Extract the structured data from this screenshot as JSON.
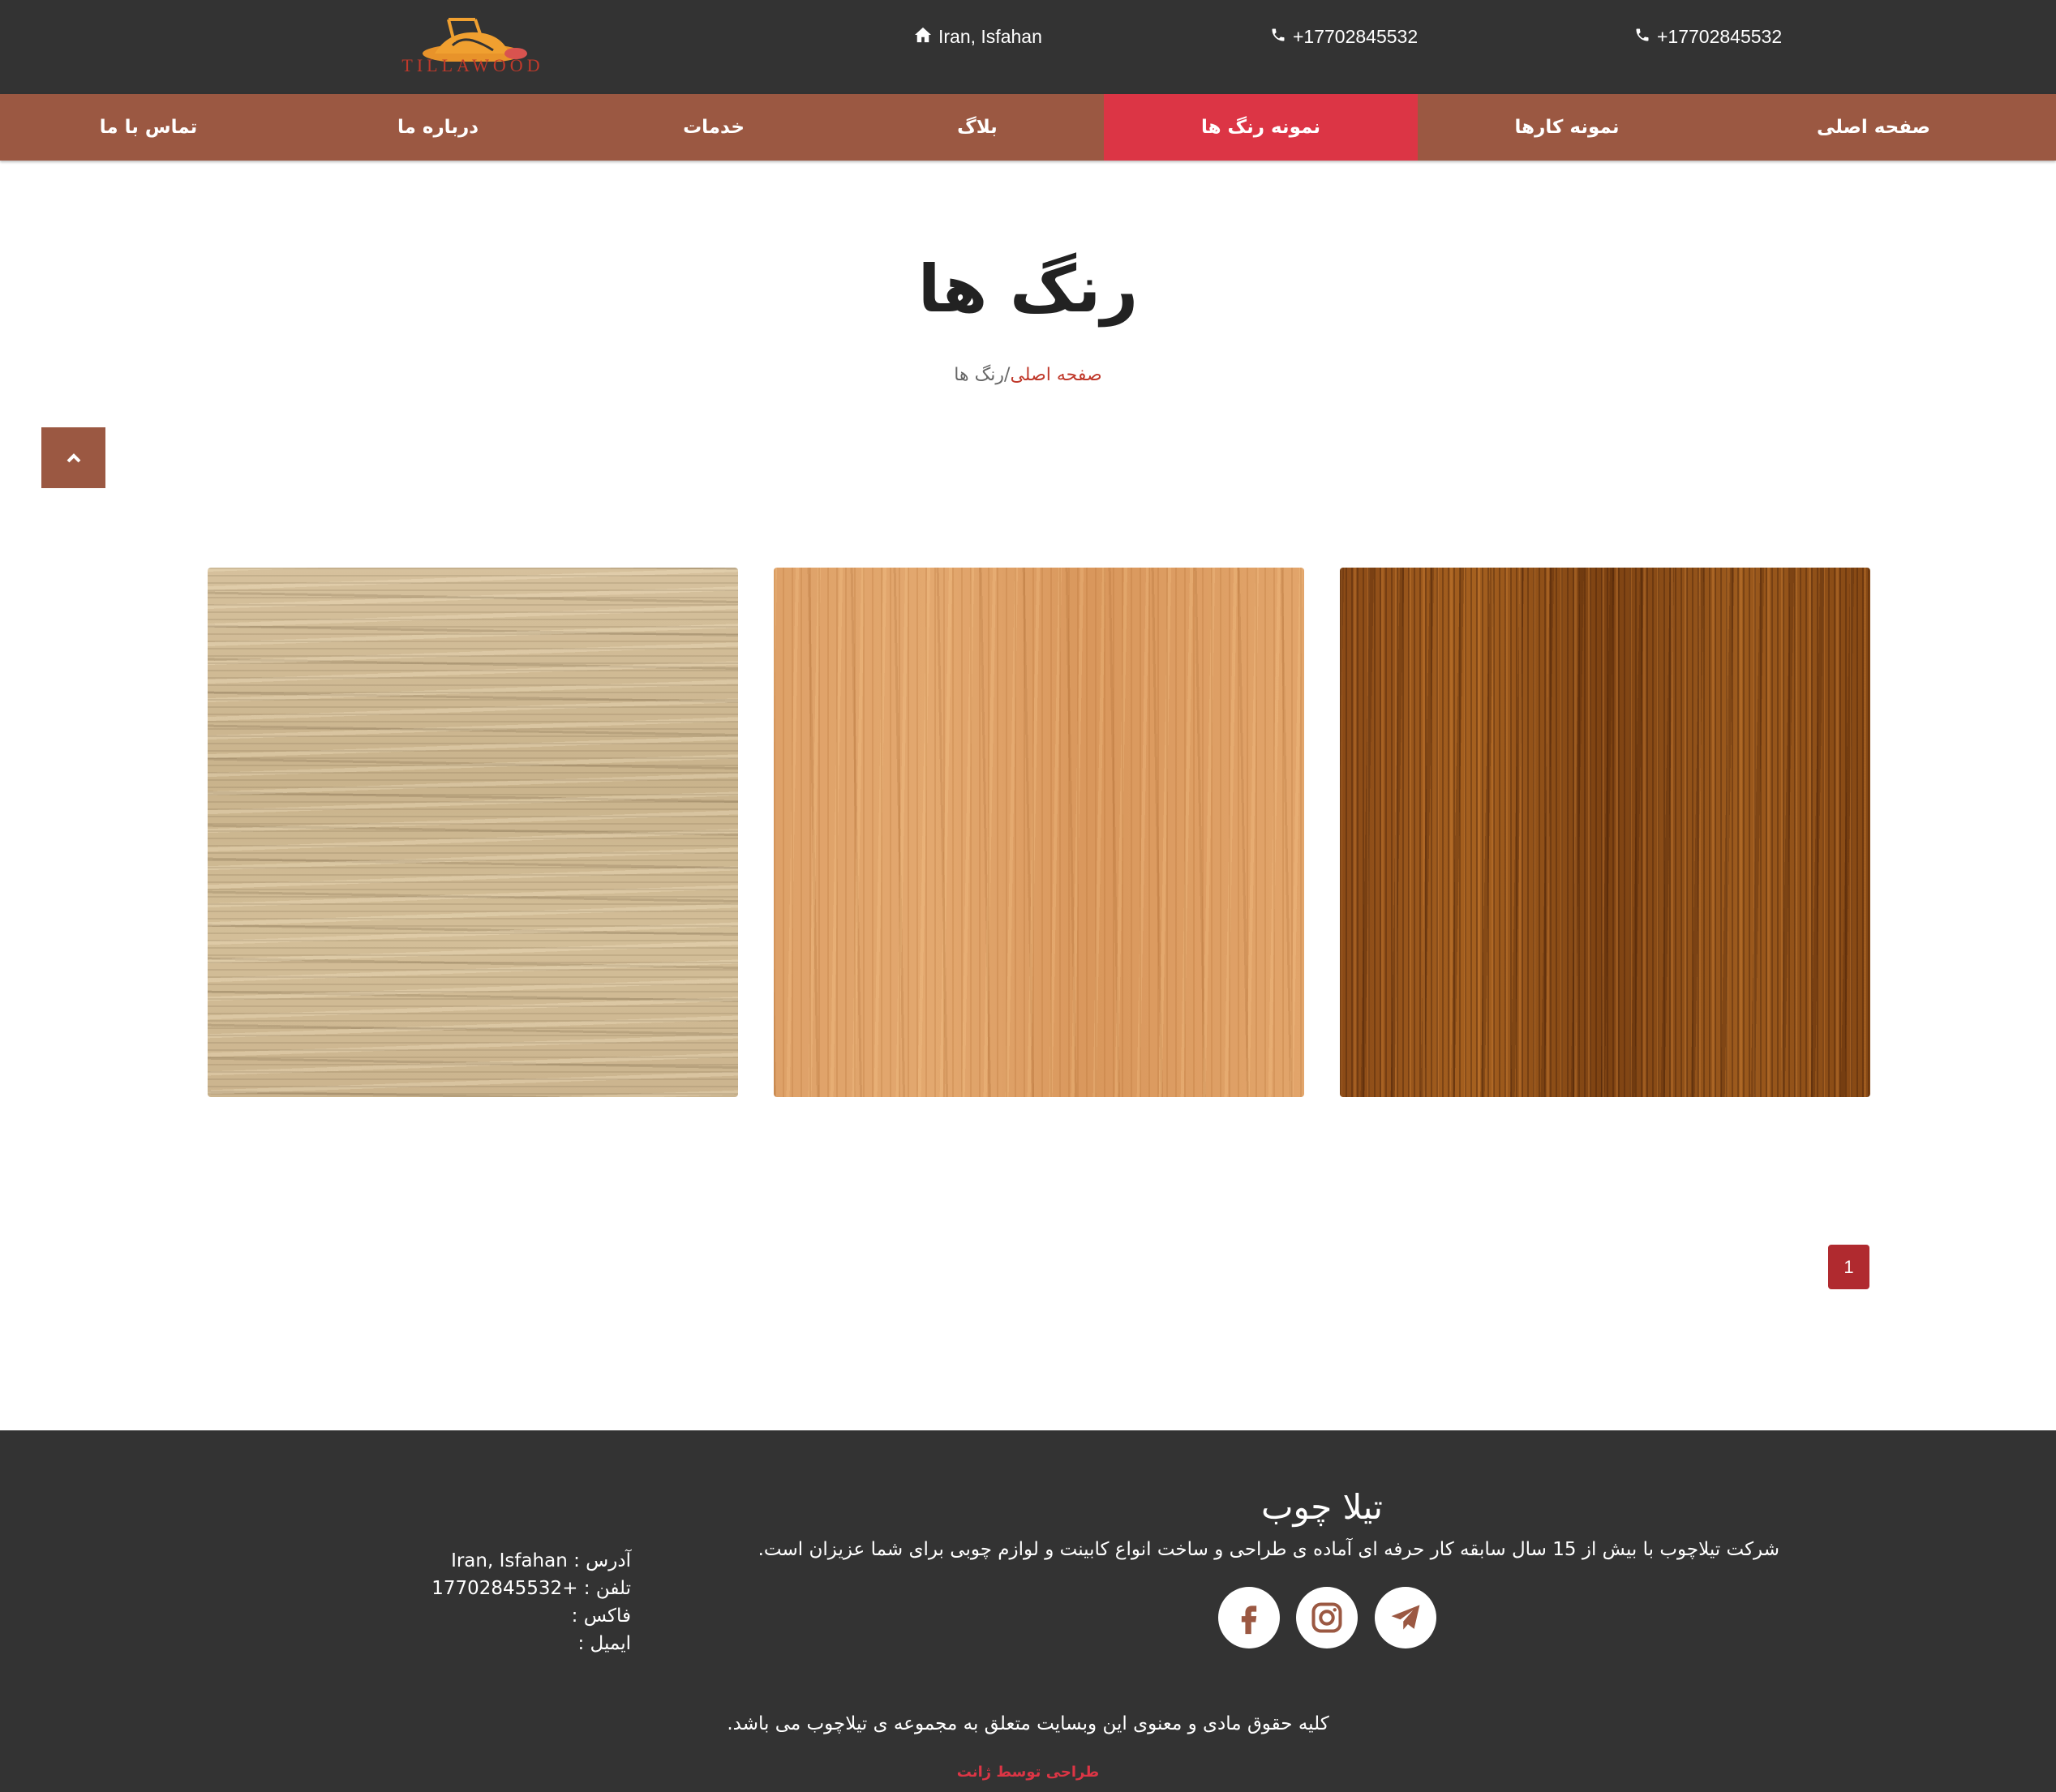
{
  "colors": {
    "dark_bg": "#333333",
    "nav_bg": "#9b5842",
    "active_nav": "#dc3545",
    "link_red": "#c0392b",
    "pager_bg": "#b02a2f"
  },
  "header": {
    "logo_text": "TILLAWOOD",
    "address": "Iran, Isfahan",
    "phone_1": "+17702845532",
    "phone_2": "+17702845532",
    "address_icon": "home-icon",
    "phone_icon": "phone-icon"
  },
  "nav": {
    "items": [
      {
        "label": "صفحه اصلی",
        "active": false
      },
      {
        "label": "نمونه کارها",
        "active": false
      },
      {
        "label": "نمونه رنگ ها",
        "active": true
      },
      {
        "label": "بلاگ",
        "active": false
      },
      {
        "label": "خدمات",
        "active": false
      },
      {
        "label": "درباره ما",
        "active": false
      },
      {
        "label": "تماس با ما",
        "active": false
      }
    ]
  },
  "page": {
    "title": "رنگ ها",
    "breadcrumb_home": "صفحه اصلی",
    "breadcrumb_sep": "/",
    "breadcrumb_current": "رنگ ها",
    "scroll_top_icon": "chevron-up-icon"
  },
  "pagination": {
    "current_page": "1"
  },
  "footer": {
    "title": "تیلا چوب",
    "description": "شرکت تیلاچوب با بیش از 15 سال سابقه کار حرفه ای آماده ی طراحی و ساخت انواع کابینت و لوازم چوبی برای شما عزیزان است.",
    "address": "آدرس : Iran, Isfahan",
    "phone": "تلفن : +17702845532",
    "fax": "فاکس :",
    "email": "ایمیل :",
    "copyright": "کلیه حقوق مادی و معنوی این وبسایت متعلق به مجموعه ی تیلاچوب می باشد.",
    "designer": "طراحی توسط ژانت",
    "social_icons": [
      "facebook-icon",
      "instagram-icon",
      "telegram-icon"
    ]
  }
}
